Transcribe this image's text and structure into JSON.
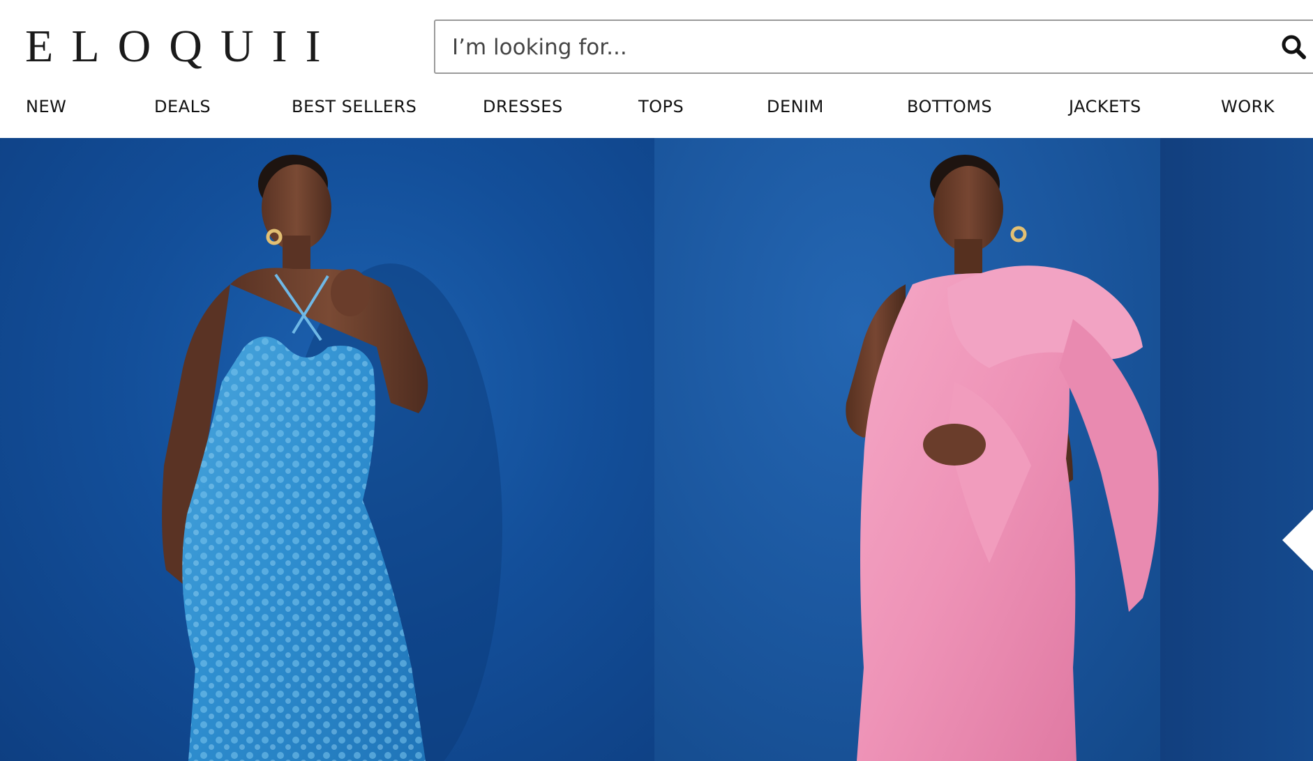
{
  "brand": {
    "logo_text": "ELOQUII"
  },
  "search": {
    "placeholder": "I’m looking for...",
    "button_icon": "search-icon"
  },
  "nav": {
    "items": [
      {
        "label": "NEW"
      },
      {
        "label": "DEALS"
      },
      {
        "label": "BEST SELLERS"
      },
      {
        "label": "DRESSES"
      },
      {
        "label": "TOPS"
      },
      {
        "label": "DENIM"
      },
      {
        "label": "BOTTOMS"
      },
      {
        "label": "JACKETS"
      },
      {
        "label": "WORK"
      }
    ]
  },
  "hero": {
    "slides": [
      {
        "subject": "model in blue sequin halter maxi dress",
        "background": "#134f9a",
        "dress_color": "#2f8fd0"
      },
      {
        "subject": "model in pink one-shoulder bow gown",
        "background": "#1b579f",
        "dress_color": "#ee93b7"
      }
    ],
    "next_arrow_icon": "chevron-left-icon"
  },
  "colors": {
    "text": "#111111",
    "hero_blue": "#134f9a",
    "accent_pink": "#ee93b7",
    "accent_sequin": "#2f8fd0"
  }
}
